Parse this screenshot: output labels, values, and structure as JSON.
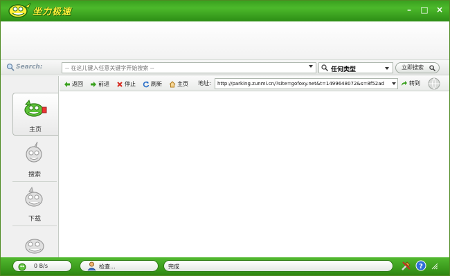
{
  "app": {
    "logo_text": "坐力极速"
  },
  "window_controls": {
    "minimize": "–",
    "maximize": "□",
    "close": "×"
  },
  "search": {
    "label": "Search:",
    "placeholder": "-- 在这儿键入任意关键字开始搜索 --",
    "type_value": "任何类型",
    "button_label": "立即搜索"
  },
  "sidebar": {
    "items": [
      {
        "label": "主页",
        "active": true
      },
      {
        "label": "搜索",
        "active": false
      },
      {
        "label": "下载",
        "active": false
      },
      {
        "label": "",
        "active": false
      }
    ]
  },
  "navbar": {
    "back": "返回",
    "forward": "前进",
    "stop": "停止",
    "refresh": "刷新",
    "home": "主页",
    "address_label": "地址:",
    "address_value": "http://parking.zunmi.cn/?site=gofoxy.net&t=1499648072&s=8f52ad",
    "go": "转到"
  },
  "status": {
    "speed": "0 B/s",
    "check": "检查...",
    "state": "完成"
  },
  "colors": {
    "accent_green": "#3aa11f",
    "logo_yellow": "#ffef3a"
  }
}
